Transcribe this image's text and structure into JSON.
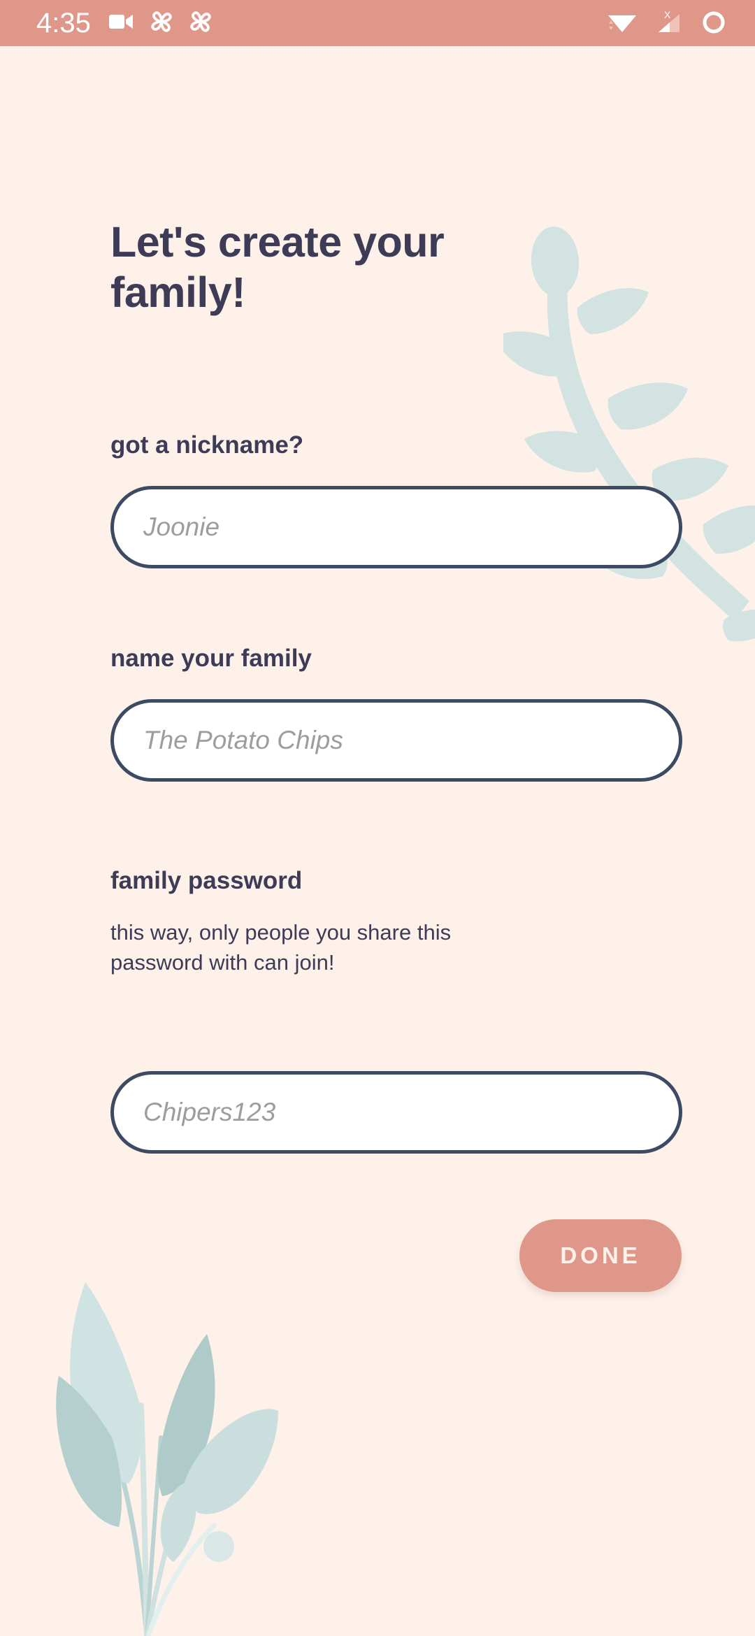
{
  "status_bar": {
    "time": "4:35",
    "left_icons": [
      "video-camera-icon",
      "pinwheel-icon",
      "pinwheel-icon"
    ],
    "right_icons": [
      "wifi-icon",
      "cellular-signal-no-sim-icon",
      "battery-ring-icon"
    ],
    "background_color": "#DF978A"
  },
  "screen": {
    "background_color": "#FDF1EA",
    "title": "Let's create your family!"
  },
  "form": {
    "fields": [
      {
        "label": "got a nickname?",
        "placeholder": "Joonie",
        "value": "",
        "helper": ""
      },
      {
        "label": "name your family",
        "placeholder": "The Potato Chips",
        "value": "",
        "helper": ""
      },
      {
        "label": "family password",
        "placeholder": "Chipers123",
        "value": "",
        "helper": "this way, only people you share this password with can join!"
      }
    ],
    "submit_label": "DONE",
    "submit_color": "#DF978A"
  },
  "theme": {
    "text_dark": "#3E3B56",
    "input_border": "#3C4B63",
    "placeholder": "#9D9D9D",
    "accent": "#DF978A",
    "leaf_light": "#D3E3E2",
    "leaf_mid": "#BBD4D3",
    "leaf_pale": "#E2EFEC"
  },
  "decorations": [
    {
      "name": "vine-branch-top-right"
    },
    {
      "name": "leaf-bouquet-bottom-left"
    }
  ]
}
